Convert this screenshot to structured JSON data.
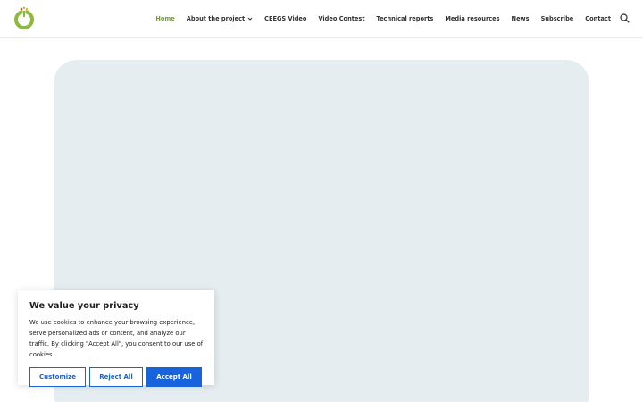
{
  "header": {
    "logo": {
      "icon": "ceegs-logo-icon",
      "colors": [
        "#8cba3c",
        "#e5413e",
        "#f1b82d"
      ]
    },
    "nav": [
      {
        "label": "Home",
        "active": true,
        "has_dropdown": false
      },
      {
        "label": "About the project",
        "active": false,
        "has_dropdown": true
      },
      {
        "label": "CEEGS Video",
        "active": false,
        "has_dropdown": false
      },
      {
        "label": "Video Contest",
        "active": false,
        "has_dropdown": false
      },
      {
        "label": "Technical reports",
        "active": false,
        "has_dropdown": false
      },
      {
        "label": "Media resources",
        "active": false,
        "has_dropdown": false
      },
      {
        "label": "News",
        "active": false,
        "has_dropdown": false
      },
      {
        "label": "Subscribe",
        "active": false,
        "has_dropdown": false
      },
      {
        "label": "Contact",
        "active": false,
        "has_dropdown": false
      }
    ],
    "search_icon": "search-icon"
  },
  "colors": {
    "active_nav": "#7a9a3a",
    "hero_bg": "#e5edf1",
    "button_accent": "#1863dc"
  },
  "cookie_banner": {
    "title": "We value your privacy",
    "text": "We use cookies to enhance your browsing experience, serve personalized ads or content, and analyze our traffic. By clicking \"Accept All\", you consent to our use of cookies.",
    "buttons": {
      "customize": "Customize",
      "reject": "Reject All",
      "accept": "Accept All"
    }
  }
}
